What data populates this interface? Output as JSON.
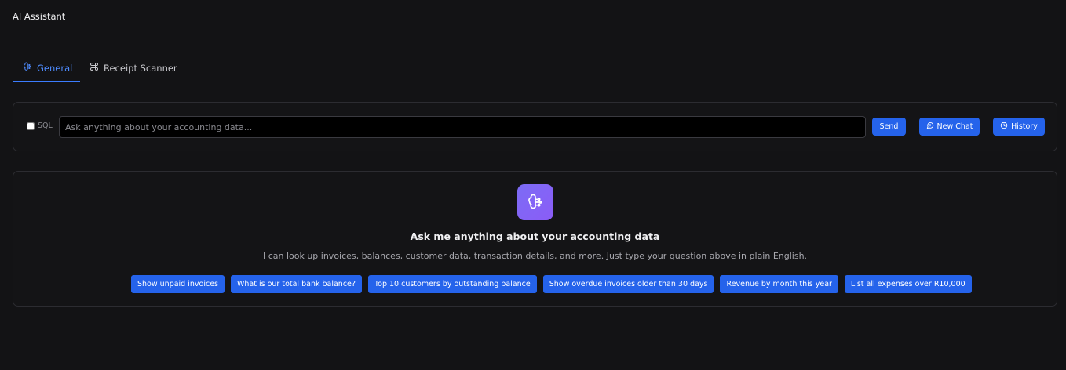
{
  "header": {
    "title": "AI Assistant"
  },
  "tabs": [
    {
      "label": "General",
      "icon": "brain-circuit-icon",
      "active": true
    },
    {
      "label": "Receipt Scanner",
      "icon": "scan-icon",
      "active": false
    }
  ],
  "chat": {
    "sql_label": "SQL",
    "sql_checked": false,
    "input_placeholder": "Ask anything about your accounting data...",
    "input_value": "",
    "send_label": "Send",
    "new_chat_label": "New Chat",
    "history_label": "History"
  },
  "empty_state": {
    "icon": "brain-circuit-icon",
    "title": "Ask me anything about your accounting data",
    "subtitle": "I can look up invoices, balances, customer data, transaction details, and more. Just type your question above in plain English.",
    "suggestions": [
      "Show unpaid invoices",
      "What is our total bank balance?",
      "Top 10 customers by outstanding balance",
      "Show overdue invoices older than 30 days",
      "Revenue by month this year",
      "List all expenses over R10,000"
    ]
  },
  "colors": {
    "background": "#131315",
    "accent": "#2563eb",
    "active_tab": "#4f8cff",
    "hero_icon": "#8b5cf6"
  }
}
